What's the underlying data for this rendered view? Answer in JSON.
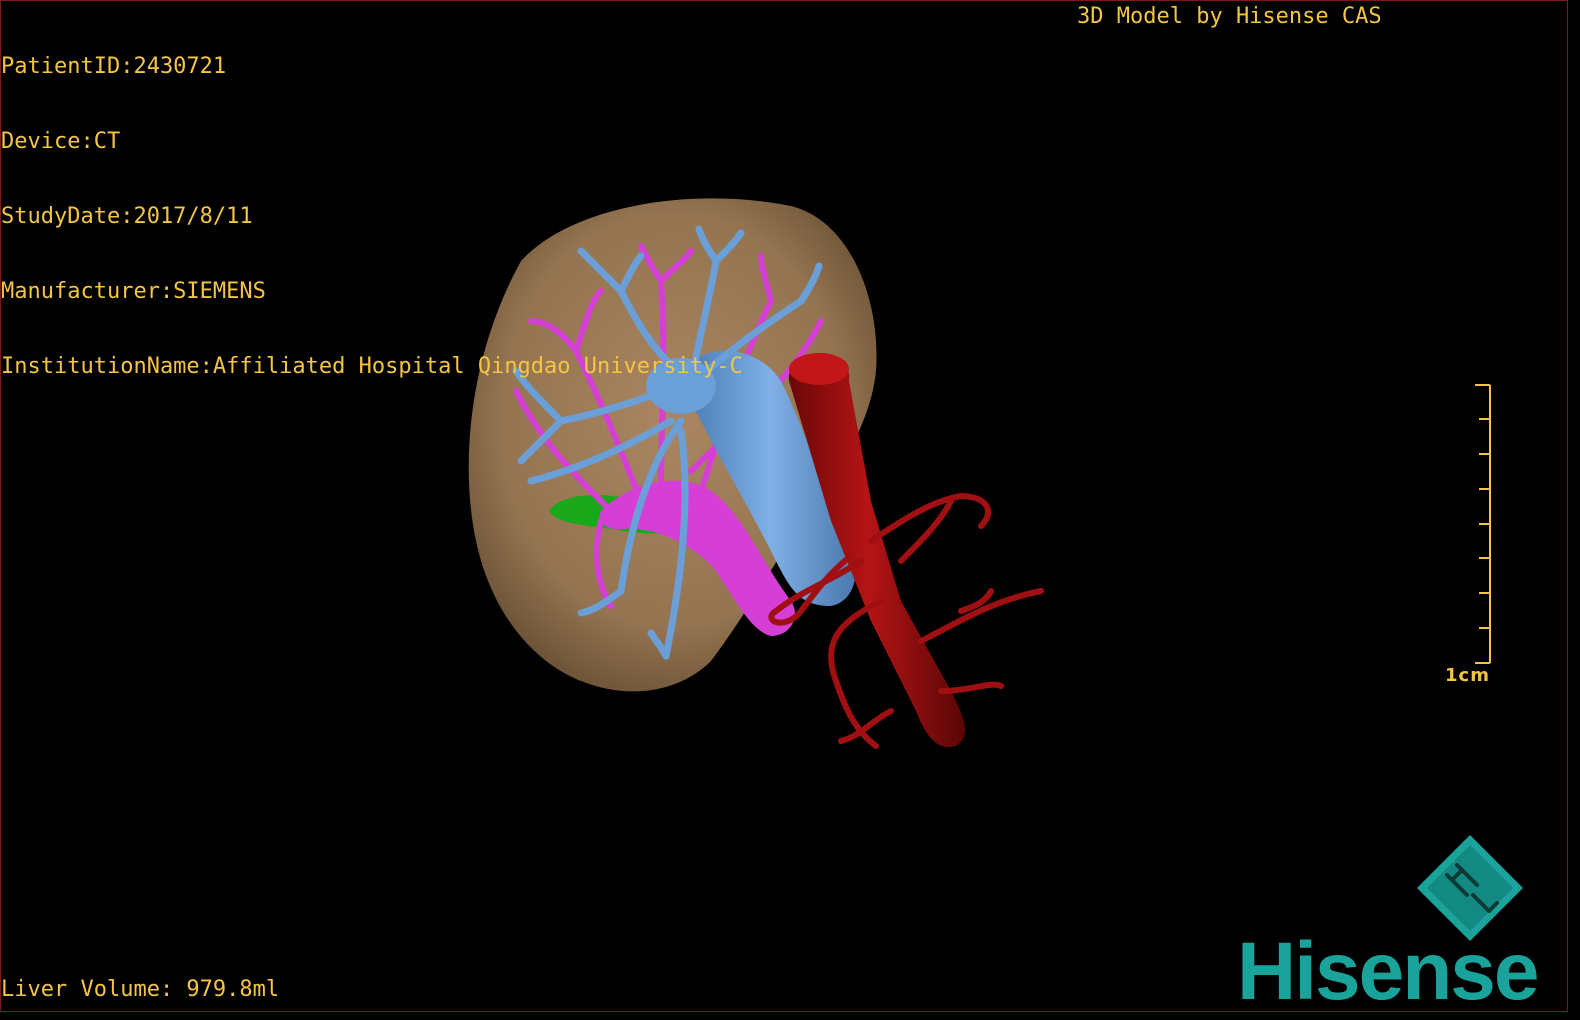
{
  "overlay": {
    "patient_id": "PatientID:2430721",
    "device": "Device:CT",
    "study_date": "StudyDate:2017/8/11",
    "manufacturer": "Manufacturer:SIEMENS",
    "institution": "InstitutionName:Affiliated Hospital Qingdao University-C",
    "vendor": "3D Model by Hisense CAS",
    "liver_volume": "Liver Volume: 979.8ml"
  },
  "scale": {
    "label": "1cm"
  },
  "logo": {
    "wordmark": "Hisense",
    "mark_letters": "HL"
  },
  "colors": {
    "overlay_text": "#f4c542",
    "liver": "#a98560",
    "hepatic_vein": "#6a9fd8",
    "portal_vein": "#d63fd6",
    "aorta": "#a00f12",
    "gallbladder": "#1aa81a",
    "brand": "#1aa39a"
  }
}
